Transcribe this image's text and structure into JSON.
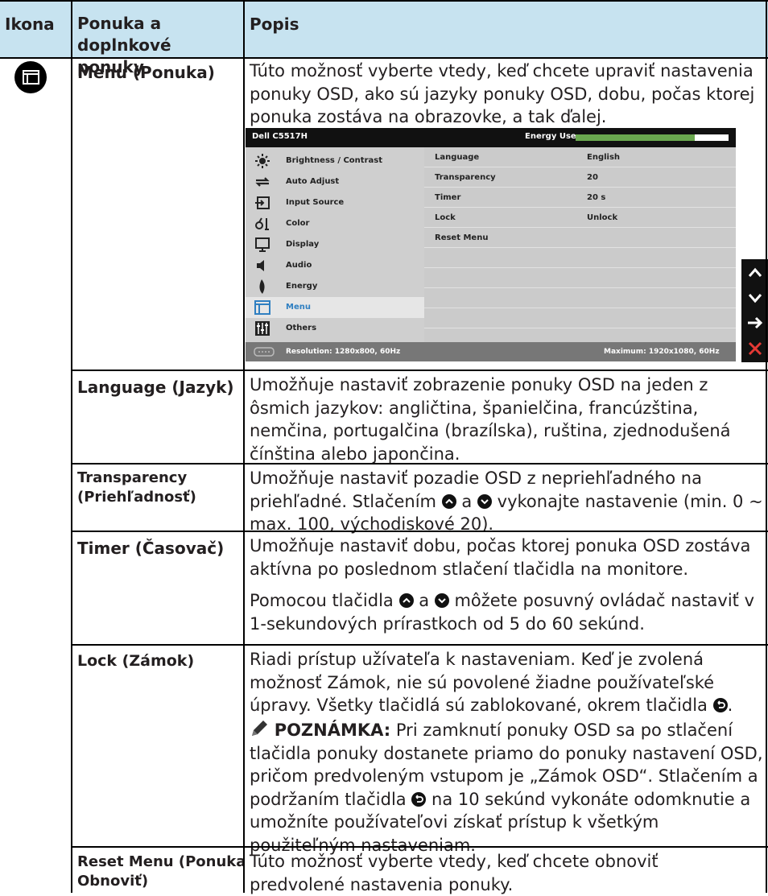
{
  "table": {
    "headers": [
      "Ikona",
      "Ponuka a doplnkové ponuky",
      "Popis"
    ],
    "menu_row": {
      "label": "Menu (Ponuka)",
      "description": "Túto možnosť vyberte vtedy, keď chcete upraviť nastavenia ponuky OSD, ako sú jazyky ponuky OSD, dobu, počas ktorej ponuka zostáva na obrazovke, a tak ďalej."
    },
    "rows": [
      {
        "label": "Language (Jazyk)",
        "description": "Umožňuje nastaviť zobrazenie ponuky OSD na jeden z ôsmich jazykov: angličtina, španielčina, francúzština, nemčina, portugalčina (brazílska), ruština, zjednodušená čínština alebo japončina."
      },
      {
        "label": "Transparency (Priehľadnosť)",
        "description_a": "Umožňuje nastaviť pozadie OSD z nepriehľadného na priehľadné. Stlačením",
        "description_b": "a",
        "description_c": "vykonajte nastavenie (min. 0 ~ max. 100, východiskové 20)."
      },
      {
        "label": "Timer (Časovač)",
        "description": "Umožňuje nastaviť dobu, počas ktorej ponuka OSD zostáva aktívna po poslednom stlačení tlačidla na monitore.",
        "description2_a": "Pomocou tlačidla",
        "description2_b": "a",
        "description2_c": "môžete posuvný ovládač nastaviť v 1-sekundových prírastkoch od 5 do 60 sekúnd."
      },
      {
        "label": "Lock (Zámok)",
        "description": "Riadi prístup užívateľa k nastaveniam. Keď je zvolená možnosť Zámok, nie sú povolené žiadne používateľské úpravy. Všetky tlačidlá sú zablokované, okrem tlačidla",
        "note_label": "POZNÁMKA:",
        "note_a": "Pri zamknutí ponuky OSD sa po stlačení tlačidla ponuky dostanete priamo do ponuky nastavení OSD, pričom predvoleným vstupom je „Zámok OSD“. Stlačením a podržaním tlačidla",
        "note_b": "na 10 sekúnd vykonáte odomknutie a umožníte používateľovi získať prístup k všetkým použiteľným nastaveniam."
      },
      {
        "label": "Reset Menu (Ponuka Obnoviť)",
        "description": "Túto možnosť vyberte vtedy, keď chcete obnoviť predvolené nastavenia ponuky."
      }
    ]
  },
  "osd": {
    "title": "Dell C5517H",
    "energy_label": "Energy Use",
    "energy_level": 0.78,
    "sidebar": [
      {
        "label": "Brightness / Contrast",
        "icon": "brightness-icon"
      },
      {
        "label": "Auto Adjust",
        "icon": "auto-adjust-icon"
      },
      {
        "label": "Input Source",
        "icon": "input-source-icon"
      },
      {
        "label": "Color",
        "icon": "color-icon"
      },
      {
        "label": "Display",
        "icon": "display-icon"
      },
      {
        "label": "Audio",
        "icon": "audio-icon"
      },
      {
        "label": "Energy",
        "icon": "energy-icon"
      },
      {
        "label": "Menu",
        "icon": "menu-icon",
        "active": true
      },
      {
        "label": "Others",
        "icon": "others-icon"
      }
    ],
    "panel": [
      {
        "key": "Language",
        "value": "English"
      },
      {
        "key": "Transparency",
        "value": "20"
      },
      {
        "key": "Timer",
        "value": "20 s"
      },
      {
        "key": "Lock",
        "value": "Unlock"
      },
      {
        "key": "Reset Menu",
        "value": ""
      }
    ],
    "status_resolution": "Resolution: 1280x800, 60Hz",
    "status_max": "Maximum: 1920x1080, 60Hz",
    "accent_color": "#2f7fc1",
    "header_color": "#c7e3f0"
  },
  "nav_buttons": [
    "up-arrow-icon",
    "down-arrow-icon",
    "enter-arrow-icon",
    "close-icon"
  ]
}
